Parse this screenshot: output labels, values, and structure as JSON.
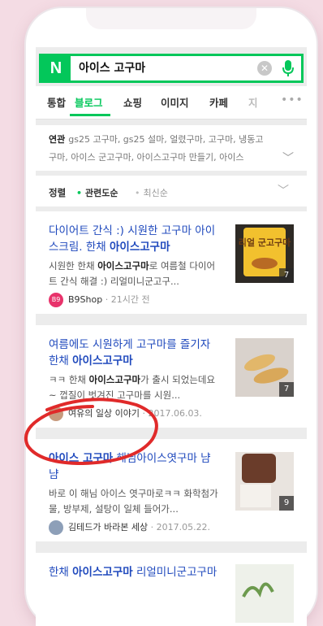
{
  "search": {
    "logo_letter": "N",
    "query": "아이스 고구마"
  },
  "tabs": [
    {
      "label": "통합"
    },
    {
      "label": "블로그",
      "active": true
    },
    {
      "label": "쇼핑"
    },
    {
      "label": "이미지"
    },
    {
      "label": "카페"
    },
    {
      "label": "지"
    }
  ],
  "related": {
    "label": "연관",
    "line1": "gs25 고구마, gs25 설마, 얼렸구마, 고구마, 냉동고",
    "line2": "구마, 아이스 군고구마, 아이스고구마 만들기, 아이스"
  },
  "sort": {
    "label": "정렬",
    "options": [
      "관련도순",
      "최신순"
    ]
  },
  "results": [
    {
      "title_pre": "다이어트 간식 :) 시원한 고구마 아이스크림. 한채 ",
      "title_bold": "아이스고구마",
      "title_post": "",
      "snippet_pre": "시원한 한채 ",
      "snippet_bold": "아이스고구마",
      "snippet_post": "로 여름철 다이어트 간식 해결 :) 리얼미니군고구...",
      "source": "B9Shop",
      "avatar_text": "B9",
      "time": "21시간 전",
      "image_count": "7",
      "thumb_text": "리얼 군고구마"
    },
    {
      "title_pre": "여름에도 시원하게 고구마를 즐기자 한채 ",
      "title_bold": "아이스고구마",
      "title_post": "",
      "snippet_pre": "ㅋㅋ 한채 ",
      "snippet_bold": "아이스고구마",
      "snippet_post": "가 출시 되었는데요~ 껍질이 벗겨진 고구마를 시원...",
      "source": "여유의 일상 이야기",
      "avatar_text": "",
      "time": "2017.06.03.",
      "image_count": "7"
    },
    {
      "title_pre": "",
      "title_bold": "아이스 고구마",
      "title_post": " 해님아이스엿구마 냠냠",
      "snippet_pre": "바로 이 해님 아이스 엿구마로ㅋㅋ 화학첨가물, 방부제, 설탕이 일체 들어가...",
      "snippet_bold": "",
      "snippet_post": "",
      "source": "김테드가 바라본 세상",
      "avatar_text": "",
      "time": "2017.05.22.",
      "image_count": "9"
    },
    {
      "title_pre": "한채 ",
      "title_bold": "아이스고구마",
      "title_post": " 리얼미니군고구마"
    }
  ],
  "colors": {
    "brand": "#03c75a",
    "link": "#1f49bd",
    "annotation": "#e02a2a"
  }
}
